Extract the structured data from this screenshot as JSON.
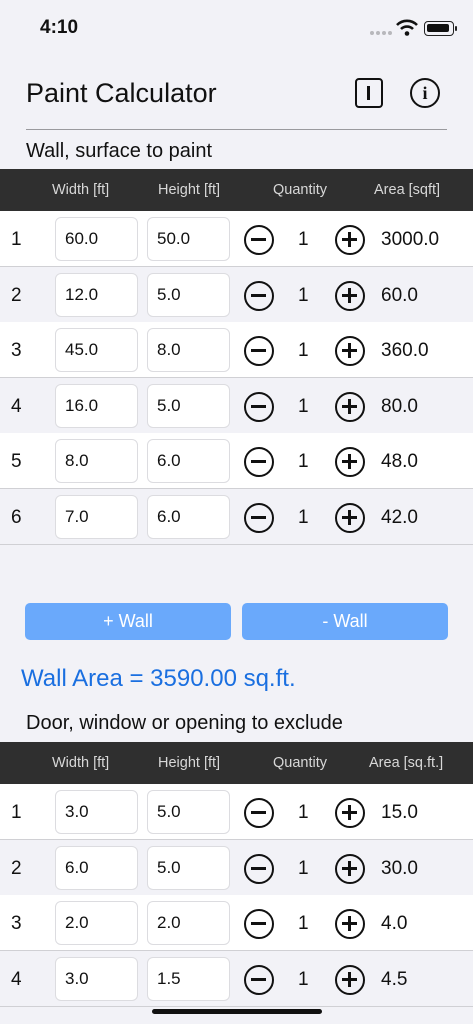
{
  "status_bar": {
    "time": "4:10"
  },
  "header": {
    "title": "Paint Calculator"
  },
  "walls": {
    "label": "Wall, surface to paint",
    "columns": [
      "Width [ft]",
      "Height [ft]",
      "Quantity",
      "Area [sqft]"
    ],
    "rows": [
      {
        "index": "1",
        "width": "60.0",
        "height": "50.0",
        "quantity": "1",
        "area": "3000.0"
      },
      {
        "index": "2",
        "width": "12.0",
        "height": "5.0",
        "quantity": "1",
        "area": "60.0"
      },
      {
        "index": "3",
        "width": "45.0",
        "height": "8.0",
        "quantity": "1",
        "area": "360.0"
      },
      {
        "index": "4",
        "width": "16.0",
        "height": "5.0",
        "quantity": "1",
        "area": "80.0"
      },
      {
        "index": "5",
        "width": "8.0",
        "height": "6.0",
        "quantity": "1",
        "area": "48.0"
      },
      {
        "index": "6",
        "width": "7.0",
        "height": "6.0",
        "quantity": "1",
        "area": "42.0"
      }
    ],
    "add_label": "+ Wall",
    "remove_label": "- Wall",
    "total": "Wall Area = 3590.00 sq.ft."
  },
  "openings": {
    "label": "Door, window or opening to exclude",
    "columns": [
      "Width [ft]",
      "Height [ft]",
      "Quantity",
      "Area [sq.ft.]"
    ],
    "rows": [
      {
        "index": "1",
        "width": "3.0",
        "height": "5.0",
        "quantity": "1",
        "area": "15.0"
      },
      {
        "index": "2",
        "width": "6.0",
        "height": "5.0",
        "quantity": "1",
        "area": "30.0"
      },
      {
        "index": "3",
        "width": "2.0",
        "height": "2.0",
        "quantity": "1",
        "area": "4.0"
      },
      {
        "index": "4",
        "width": "3.0",
        "height": "1.5",
        "quantity": "1",
        "area": "4.5"
      }
    ]
  },
  "colors": {
    "button": "#6aa9fb",
    "total_text": "#1a6fe0",
    "table_header": "#2f2f2f"
  }
}
